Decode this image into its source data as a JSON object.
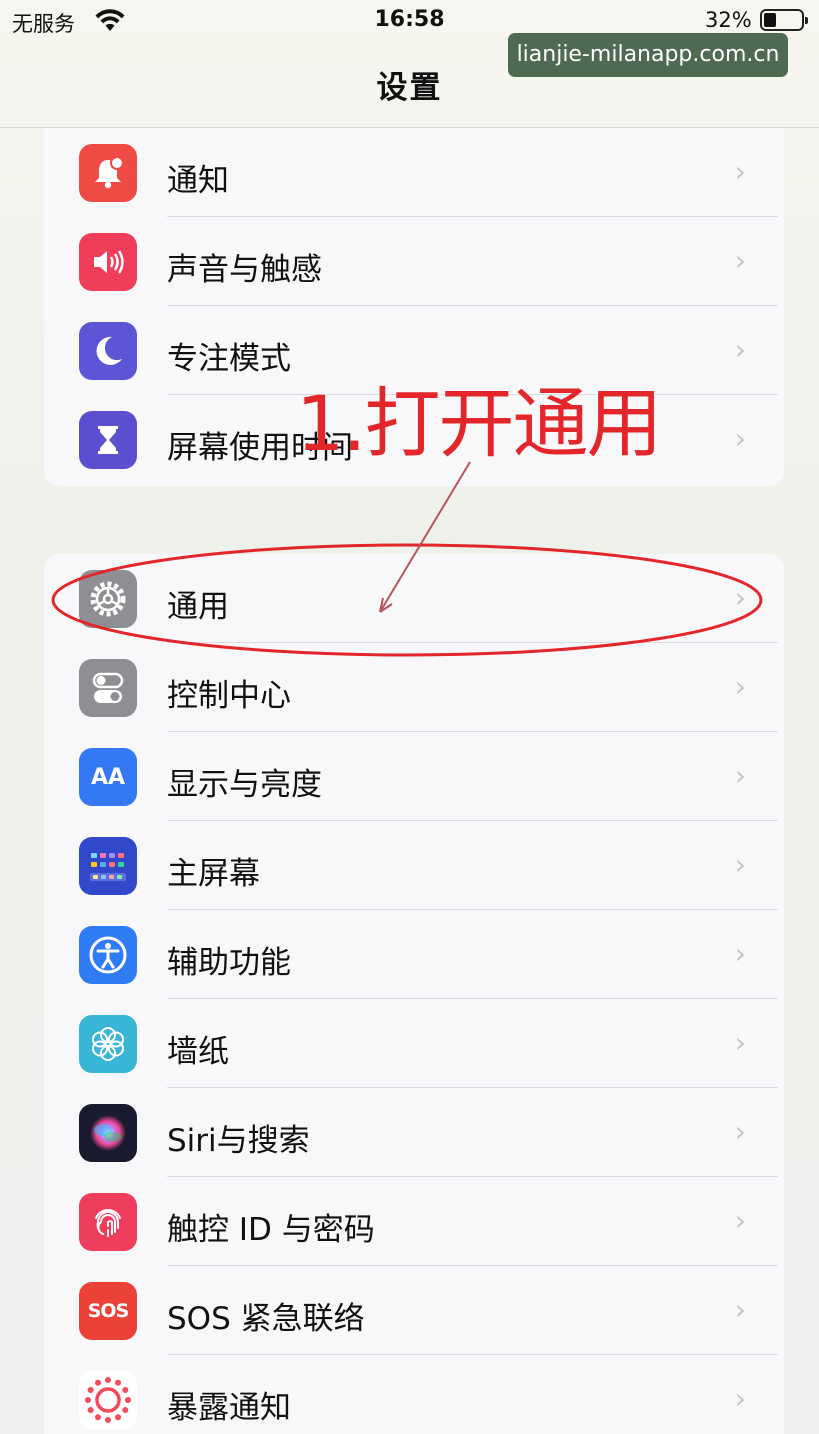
{
  "status_bar": {
    "carrier": "无服务",
    "time": "16:58",
    "battery_percent": "32%",
    "battery_level": 0.32,
    "wifi_icon": "wifi-icon"
  },
  "watermark": "lianjie-milanapp.com.cn",
  "nav": {
    "title": "设置"
  },
  "group1": {
    "items": [
      {
        "label": "通知",
        "icon": "bell-icon"
      },
      {
        "label": "声音与触感",
        "icon": "speaker-icon"
      },
      {
        "label": "专注模式",
        "icon": "moon-icon"
      },
      {
        "label": "屏幕使用时间",
        "icon": "hourglass-icon"
      }
    ]
  },
  "group2": {
    "items": [
      {
        "label": "通用",
        "icon": "gear-icon"
      },
      {
        "label": "控制中心",
        "icon": "toggle-icon"
      },
      {
        "label": "显示与亮度",
        "icon": "text-size-icon",
        "glyph": "AA"
      },
      {
        "label": "主屏幕",
        "icon": "home-grid-icon"
      },
      {
        "label": "辅助功能",
        "icon": "accessibility-icon"
      },
      {
        "label": "墙纸",
        "icon": "flower-icon"
      },
      {
        "label": "Siri与搜索",
        "icon": "siri-icon"
      },
      {
        "label": "触控 ID 与密码",
        "icon": "fingerprint-icon"
      },
      {
        "label": "SOS 紧急联络",
        "icon": "sos-icon",
        "glyph": "SOS"
      },
      {
        "label": "暴露通知",
        "icon": "exposure-icon"
      }
    ]
  },
  "chevron": "›",
  "annotation": {
    "text": "1.打开通用",
    "color": "#e3262a"
  }
}
